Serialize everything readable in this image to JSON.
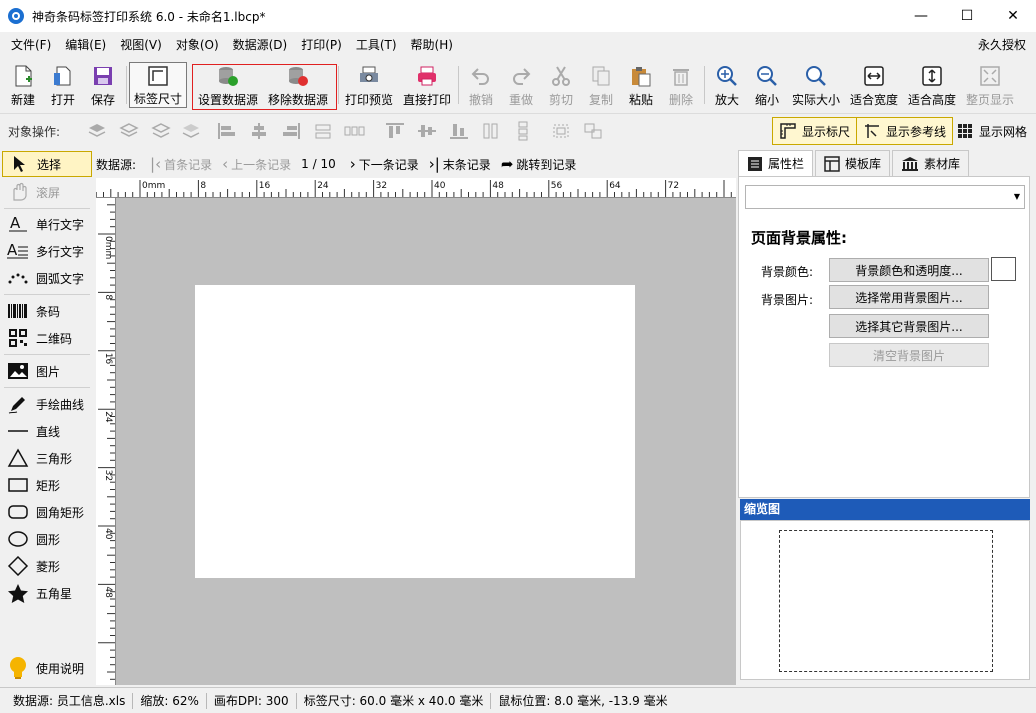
{
  "window": {
    "title": "神奇条码标签打印系统 6.0 - 未命名1.lbcp*",
    "minimize": "—",
    "maximize": "☐",
    "close": "✕"
  },
  "menu": {
    "items": [
      "文件(F)",
      "编辑(E)",
      "视图(V)",
      "对象(O)",
      "数据源(D)",
      "打印(P)",
      "工具(T)",
      "帮助(H)"
    ],
    "license": "永久授权"
  },
  "toolbar": {
    "new": "新建",
    "open": "打开",
    "save": "保存",
    "label_size": "标签尺寸",
    "set_datasource": "设置数据源",
    "remove_datasource": "移除数据源",
    "print_preview": "打印预览",
    "direct_print": "直接打印",
    "undo": "撤销",
    "redo": "重做",
    "cut": "剪切",
    "copy": "复制",
    "paste": "粘贴",
    "delete": "删除",
    "zoom_in": "放大",
    "zoom_out": "缩小",
    "actual_size": "实际大小",
    "fit_width": "适合宽度",
    "fit_height": "适合高度",
    "full_page": "整页显示"
  },
  "objbar": {
    "label": "对象操作:",
    "show_ruler": "显示标尺",
    "show_guides": "显示参考线",
    "show_grid": "显示网格"
  },
  "tools": {
    "select": "选择",
    "scroll": "滚屏",
    "single_text": "单行文字",
    "multi_text": "多行文字",
    "arc_text": "圆弧文字",
    "barcode": "条码",
    "qrcode": "二维码",
    "image": "图片",
    "freehand": "手绘曲线",
    "line": "直线",
    "triangle": "三角形",
    "rectangle": "矩形",
    "rounded_rect": "圆角矩形",
    "circle": "圆形",
    "diamond": "菱形",
    "star": "五角星",
    "help": "使用说明"
  },
  "nav": {
    "label": "数据源:",
    "first": "首条记录",
    "prev": "上一条记录",
    "position": "1 / 10",
    "next": "下一条记录",
    "last": "末条记录",
    "jump": "跳转到记录"
  },
  "ruler": {
    "h_ticks": [
      "-8",
      "0mm",
      "8",
      "16",
      "24",
      "32",
      "40",
      "48",
      "56",
      "64",
      "72"
    ],
    "v_ticks": [
      "-8",
      "0mm",
      "8",
      "16",
      "24",
      "32",
      "40",
      "48"
    ]
  },
  "panel": {
    "tabs": [
      "属性栏",
      "模板库",
      "素材库"
    ],
    "section_title": "页面背景属性:",
    "bg_color_label": "背景颜色:",
    "bg_color_btn": "背景颜色和透明度...",
    "bg_image_label": "背景图片:",
    "bg_common_btn": "选择常用背景图片...",
    "bg_other_btn": "选择其它背景图片...",
    "bg_clear_btn": "清空背景图片",
    "preview_title": "缩览图"
  },
  "status": {
    "datasource": "数据源: 员工信息.xls",
    "zoom": "缩放: 62%",
    "dpi": "画布DPI: 300",
    "label_size": "标签尺寸: 60.0 毫米 x 40.0 毫米",
    "cursor": "鼠标位置: 8.0 毫米, -13.9 毫米"
  },
  "colors": {
    "accent_blue": "#1e5bb8",
    "highlight_red": "#e02020",
    "canvas_gray": "#bfbfbf"
  }
}
